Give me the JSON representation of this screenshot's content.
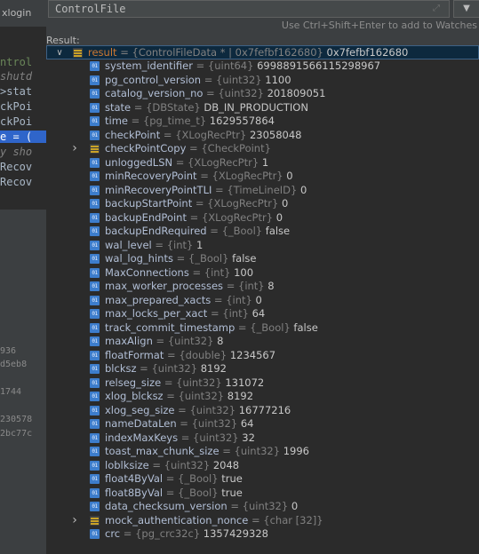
{
  "background_editor": {
    "lines": [
      "xlogin",
      "",
      "ntrol",
      "shutd",
      ">stat",
      "ckPoi",
      "ckPoi",
      "e = (",
      "y sho",
      "Recov",
      "Recov",
      "",
      "",
      "",
      "936",
      "d5eb8",
      "1744",
      "230578",
      "2bc77c"
    ]
  },
  "expression": {
    "text": "ControlFile",
    "expand_icon": "expand-arrows-icon",
    "history_icon": "dropdown-triangle-icon"
  },
  "hint": "Use Ctrl+Shift+Enter to add to Watches",
  "result_label": "Result:",
  "tree": {
    "root": {
      "name": "result",
      "type": "{ControlFileData * | 0x7fefbf162680}",
      "value": "0x7fefbf162680",
      "expanded": true
    },
    "fields": [
      {
        "name": "system_identifier",
        "type": "{uint64}",
        "value": "6998891566115298967"
      },
      {
        "name": "pg_control_version",
        "type": "{uint32}",
        "value": "1100"
      },
      {
        "name": "catalog_version_no",
        "type": "{uint32}",
        "value": "201809051"
      },
      {
        "name": "state",
        "type": "{DBState}",
        "value": "DB_IN_PRODUCTION"
      },
      {
        "name": "time",
        "type": "{pg_time_t}",
        "value": "1629557864"
      },
      {
        "name": "checkPoint",
        "type": "{XLogRecPtr}",
        "value": "23058048"
      },
      {
        "name": "checkPointCopy",
        "type": "{CheckPoint}",
        "value": "",
        "expandable": true
      },
      {
        "name": "unloggedLSN",
        "type": "{XLogRecPtr}",
        "value": "1"
      },
      {
        "name": "minRecoveryPoint",
        "type": "{XLogRecPtr}",
        "value": "0"
      },
      {
        "name": "minRecoveryPointTLI",
        "type": "{TimeLineID}",
        "value": "0"
      },
      {
        "name": "backupStartPoint",
        "type": "{XLogRecPtr}",
        "value": "0"
      },
      {
        "name": "backupEndPoint",
        "type": "{XLogRecPtr}",
        "value": "0"
      },
      {
        "name": "backupEndRequired",
        "type": "{_Bool}",
        "value": "false"
      },
      {
        "name": "wal_level",
        "type": "{int}",
        "value": "1"
      },
      {
        "name": "wal_log_hints",
        "type": "{_Bool}",
        "value": "false"
      },
      {
        "name": "MaxConnections",
        "type": "{int}",
        "value": "100"
      },
      {
        "name": "max_worker_processes",
        "type": "{int}",
        "value": "8"
      },
      {
        "name": "max_prepared_xacts",
        "type": "{int}",
        "value": "0"
      },
      {
        "name": "max_locks_per_xact",
        "type": "{int}",
        "value": "64"
      },
      {
        "name": "track_commit_timestamp",
        "type": "{_Bool}",
        "value": "false"
      },
      {
        "name": "maxAlign",
        "type": "{uint32}",
        "value": "8"
      },
      {
        "name": "floatFormat",
        "type": "{double}",
        "value": "1234567"
      },
      {
        "name": "blcksz",
        "type": "{uint32}",
        "value": "8192"
      },
      {
        "name": "relseg_size",
        "type": "{uint32}",
        "value": "131072"
      },
      {
        "name": "xlog_blcksz",
        "type": "{uint32}",
        "value": "8192"
      },
      {
        "name": "xlog_seg_size",
        "type": "{uint32}",
        "value": "16777216"
      },
      {
        "name": "nameDataLen",
        "type": "{uint32}",
        "value": "64"
      },
      {
        "name": "indexMaxKeys",
        "type": "{uint32}",
        "value": "32"
      },
      {
        "name": "toast_max_chunk_size",
        "type": "{uint32}",
        "value": "1996"
      },
      {
        "name": "loblksize",
        "type": "{uint32}",
        "value": "2048"
      },
      {
        "name": "float4ByVal",
        "type": "{_Bool}",
        "value": "true"
      },
      {
        "name": "float8ByVal",
        "type": "{_Bool}",
        "value": "true"
      },
      {
        "name": "data_checksum_version",
        "type": "{uint32}",
        "value": "0"
      },
      {
        "name": "mock_authentication_nonce",
        "type": "{char [32]}",
        "value": "",
        "expandable": true
      },
      {
        "name": "crc",
        "type": "{pg_crc32c}",
        "value": "1357429328"
      }
    ]
  },
  "colors": {
    "field_icon": "#3d7dcc",
    "struct_icon": "#c9a227",
    "selection": "#0d293e",
    "result_name": "#cc7832"
  }
}
